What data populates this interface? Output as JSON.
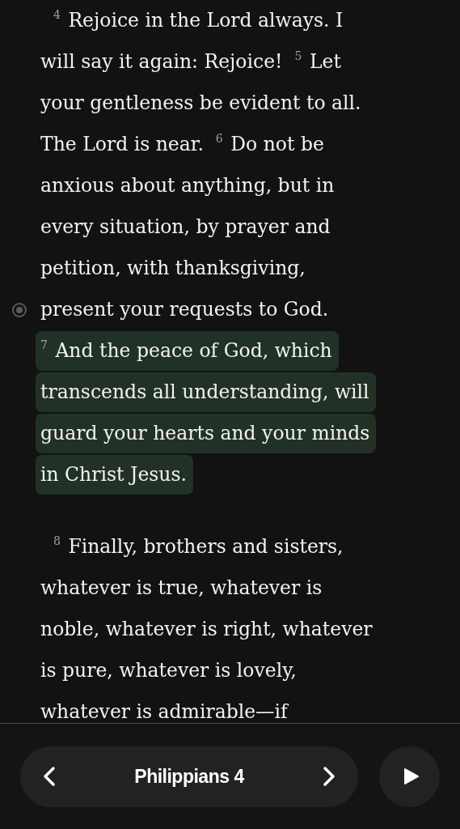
{
  "paragraphs": [
    {
      "lines": [
        {
          "text": "$^{4}$ Rejoice in the Lord always. I",
          "highlighted": false,
          "note": false
        },
        {
          "text": "will say it again: Rejoice!  $^{5}$ Let",
          "highlighted": false,
          "note": false
        },
        {
          "text": "your gentleness be evident to all.",
          "highlighted": false,
          "note": false
        },
        {
          "text": "The Lord is near.  $^{6}$ Do not be",
          "highlighted": false,
          "note": false
        },
        {
          "text": "anxious about anything, but in",
          "highlighted": false,
          "note": false
        },
        {
          "text": "every situation, by prayer and",
          "highlighted": false,
          "note": false
        },
        {
          "text": "petition, with thanksgiving,",
          "highlighted": false,
          "note": false
        },
        {
          "text": "present your requests to God.",
          "highlighted": false,
          "note": true
        },
        {
          "text": "$^{7}$ And the peace of God, which",
          "highlighted": true,
          "note": false
        },
        {
          "text": "transcends all understanding, will",
          "highlighted": true,
          "note": false
        },
        {
          "text": "guard your hearts and your minds",
          "highlighted": true,
          "note": false
        },
        {
          "text": "in Christ Jesus.",
          "highlighted": true,
          "note": false
        }
      ]
    },
    {
      "lines": [
        {
          "text": "$^{8}$ Finally, brothers and sisters,",
          "highlighted": false,
          "note": false
        },
        {
          "text": "whatever is true, whatever is",
          "highlighted": false,
          "note": false
        },
        {
          "text": "noble, whatever is right, whatever",
          "highlighted": false,
          "note": false
        },
        {
          "text": "is pure, whatever is lovely,",
          "highlighted": false,
          "note": false
        },
        {
          "text": "whatever is admirable—if",
          "highlighted": false,
          "note": false
        }
      ]
    }
  ],
  "navigation": {
    "chapter": "Philippians 4"
  }
}
